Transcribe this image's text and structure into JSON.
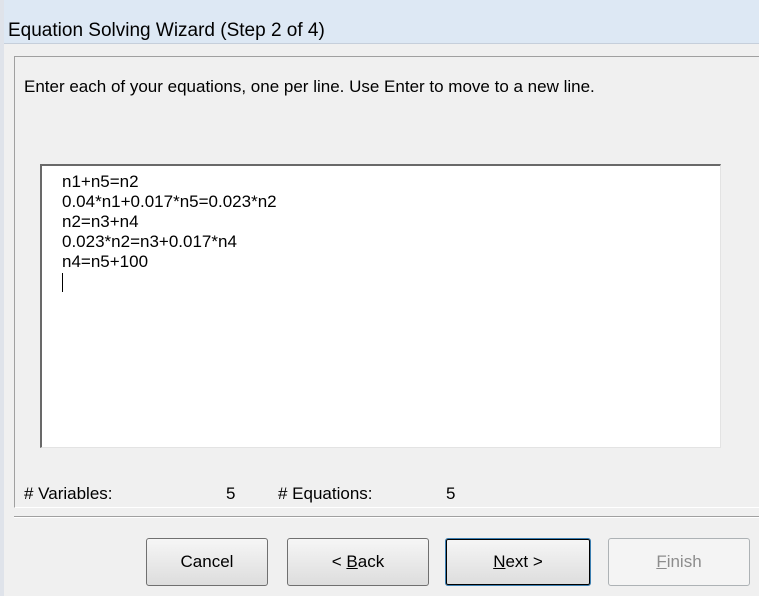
{
  "window": {
    "title": "Equation Solving Wizard (Step 2 of 4)"
  },
  "instructions": "Enter each of your equations, one per line. Use Enter to move to a new line.",
  "equations": [
    "n1+n5=n2",
    "0.04*n1+0.017*n5=0.023*n2",
    "n2=n3+n4",
    "0.023*n2=n3+0.017*n4",
    "n4=n5+100"
  ],
  "counts": {
    "variables_label": "# Variables:",
    "variables_value": "5",
    "equations_label": "# Equations:",
    "equations_value": "5"
  },
  "buttons": {
    "cancel": "Cancel",
    "back_prefix": "< ",
    "back_mnemonic": "B",
    "back_rest": "ack",
    "next_mnemonic": "N",
    "next_rest": "ext >",
    "finish_mnemonic": "F",
    "finish_rest": "inish"
  }
}
